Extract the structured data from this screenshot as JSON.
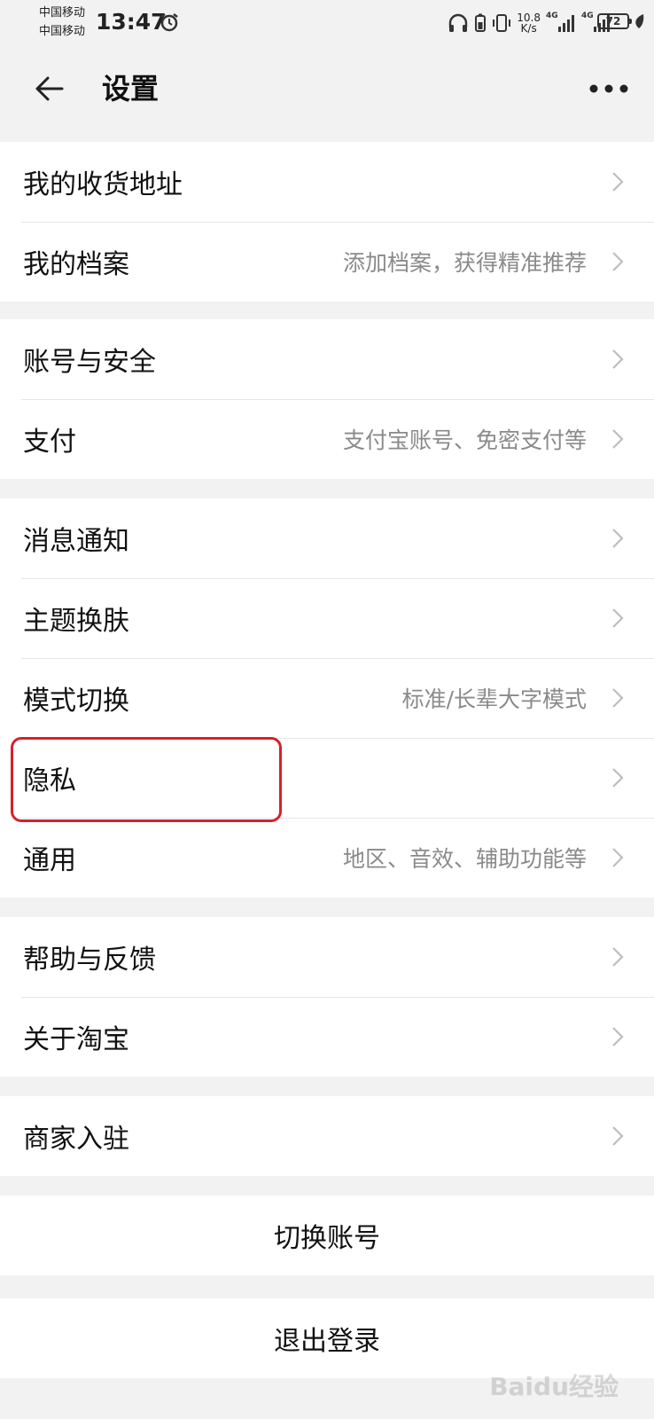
{
  "status_bar": {
    "carrier_1": "中国移动",
    "carrier_2": "中国移动",
    "time": "13:47",
    "net_speed_value": "10.8",
    "net_speed_unit": "K/s",
    "signal_1_label": "4G",
    "signal_2_label": "4G",
    "battery_level": "72"
  },
  "header": {
    "title": "设置"
  },
  "groups": [
    {
      "items": [
        {
          "label": "我的收货地址",
          "desc": ""
        },
        {
          "label": "我的档案",
          "desc": "添加档案，获得精准推荐"
        }
      ]
    },
    {
      "items": [
        {
          "label": "账号与安全",
          "desc": ""
        },
        {
          "label": "支付",
          "desc": "支付宝账号、免密支付等"
        }
      ]
    },
    {
      "items": [
        {
          "label": "消息通知",
          "desc": ""
        },
        {
          "label": "主题换肤",
          "desc": ""
        },
        {
          "label": "模式切换",
          "desc": "标准/长辈大字模式"
        },
        {
          "label": "隐私",
          "desc": ""
        },
        {
          "label": "通用",
          "desc": "地区、音效、辅助功能等"
        }
      ]
    },
    {
      "items": [
        {
          "label": "帮助与反馈",
          "desc": ""
        },
        {
          "label": "关于淘宝",
          "desc": ""
        }
      ]
    },
    {
      "items": [
        {
          "label": "商家入驻",
          "desc": ""
        }
      ]
    }
  ],
  "actions": {
    "switch_account": "切换账号",
    "logout": "退出登录"
  },
  "annotation": {
    "highlight_color": "#d8202c"
  },
  "watermark": "Baidu经验"
}
